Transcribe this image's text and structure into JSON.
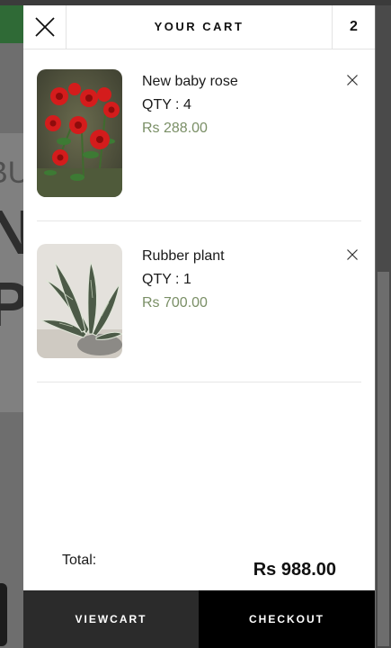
{
  "background": {
    "hero_line1": "BU",
    "hero_line2": "N",
    "hero_line3": "P"
  },
  "cart": {
    "title": "YOUR CART",
    "count": "2",
    "close_icon": "close-icon",
    "items": [
      {
        "name": "New baby rose",
        "qty": "QTY : 4",
        "price": "Rs 288.00",
        "image": "red-roses"
      },
      {
        "name": "Rubber plant",
        "qty": "QTY : 1",
        "price": "Rs 700.00",
        "image": "rubber-plant"
      }
    ],
    "total_label": "Total:",
    "total_value": "Rs 988.00",
    "viewcart_label": "VIEWCART",
    "checkout_label": "CHECKOUT",
    "price_color": "#7a8f66"
  }
}
